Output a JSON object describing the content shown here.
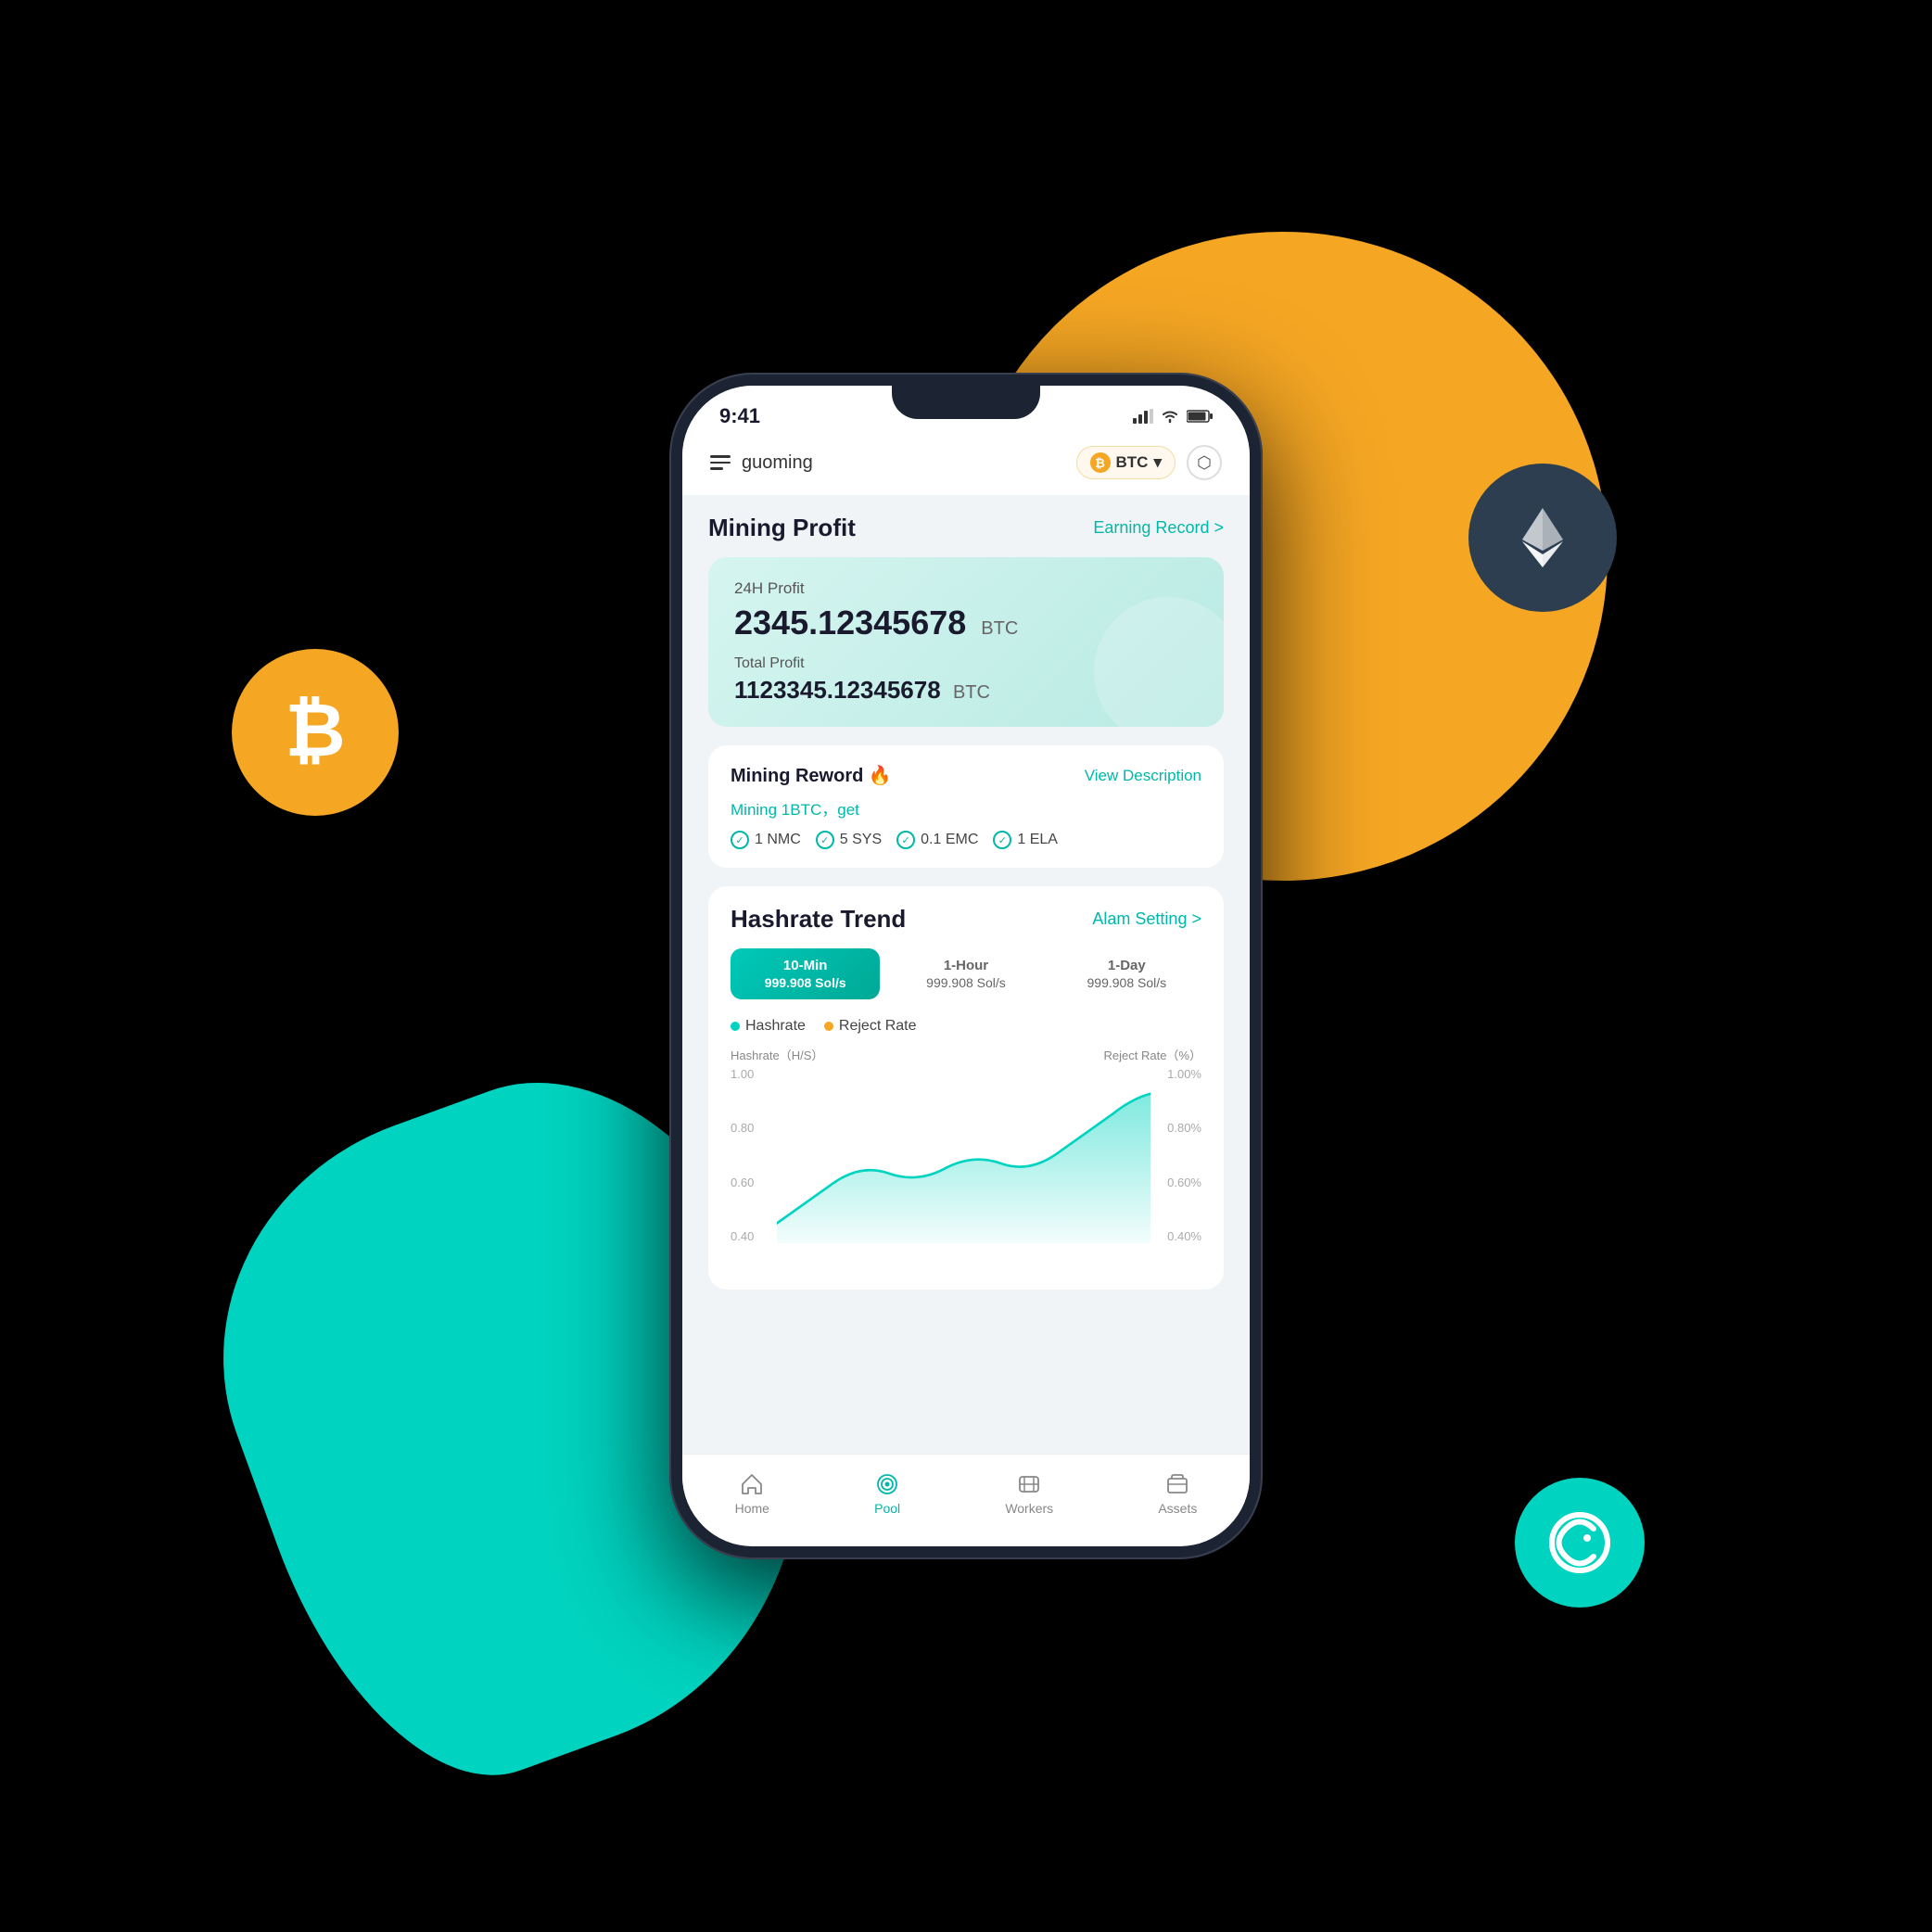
{
  "background": {
    "btc_symbol": "₿",
    "eth_symbol": "⟠",
    "green_c_symbol": "©"
  },
  "statusBar": {
    "time": "9:41",
    "signal": "▂▄▆",
    "wifi": "WiFi",
    "battery": "🔋"
  },
  "header": {
    "menuLabel": "≡",
    "username": "guoming",
    "btcBadge": "BTC",
    "settingsIcon": "⬡"
  },
  "miningProfit": {
    "title": "Mining Profit",
    "earningRecord": "Earning Record",
    "earningRecordArrow": ">",
    "profit24hLabel": "24H Profit",
    "profit24hValue": "2345.12345678",
    "profit24hCurrency": "BTC",
    "totalProfitLabel": "Total Profit",
    "totalProfitValue": "1123345.12345678",
    "totalProfitCurrency": "BTC"
  },
  "miningReward": {
    "title": "Mining Reword 🔥",
    "viewDescription": "View Description",
    "subtitle": "Mining 1BTC，get",
    "items": [
      {
        "label": "1 NMC"
      },
      {
        "label": "5 SYS"
      },
      {
        "label": "0.1 EMC"
      },
      {
        "label": "1 ELA"
      }
    ]
  },
  "hashrateTrend": {
    "title": "Hashrate Trend",
    "alarmSetting": "Alam Setting",
    "alarmArrow": ">",
    "tabs": [
      {
        "label": "10-Min",
        "value": "999.908 Sol/s",
        "active": true
      },
      {
        "label": "1-Hour",
        "value": "999.908 Sol/s",
        "active": false
      },
      {
        "label": "1-Day",
        "value": "999.908 Sol/s",
        "active": false
      }
    ],
    "legend": {
      "hashrate": "Hashrate",
      "rejectRate": "Reject Rate"
    },
    "yAxisLeft": {
      "label": "Hashrate（H/S）",
      "values": [
        "1.00",
        "0.80",
        "0.60",
        "0.40"
      ]
    },
    "yAxisRight": {
      "label": "Reject Rate（%）",
      "values": [
        "1.00%",
        "0.80%",
        "0.60%",
        "0.40%"
      ]
    }
  },
  "bottomNav": {
    "items": [
      {
        "label": "Home",
        "icon": "⌂",
        "active": false
      },
      {
        "label": "Pool",
        "icon": "◎",
        "active": true
      },
      {
        "label": "Workers",
        "icon": "◈",
        "active": false
      },
      {
        "label": "Assets",
        "icon": "▣",
        "active": false
      }
    ]
  }
}
